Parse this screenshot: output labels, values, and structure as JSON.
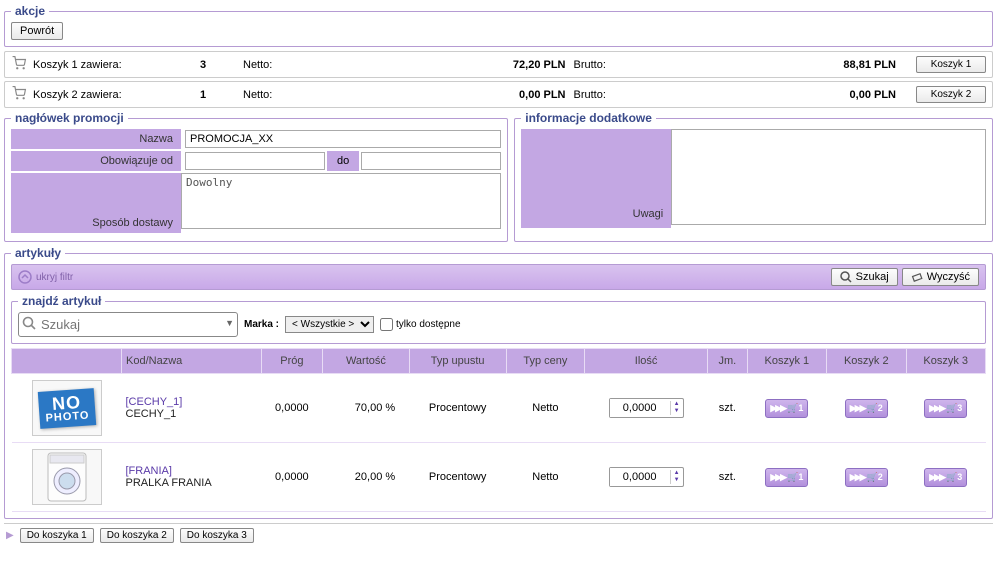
{
  "actions": {
    "legend": "akcje",
    "back": "Powrót"
  },
  "carts": [
    {
      "label": "Koszyk 1 zawiera:",
      "qty": "3",
      "netto_label": "Netto:",
      "netto": "72,20 PLN",
      "brutto_label": "Brutto:",
      "brutto": "88,81 PLN",
      "button": "Koszyk 1"
    },
    {
      "label": "Koszyk 2 zawiera:",
      "qty": "1",
      "netto_label": "Netto:",
      "netto": "0,00 PLN",
      "brutto_label": "Brutto:",
      "brutto": "0,00 PLN",
      "button": "Koszyk 2"
    }
  ],
  "promo_header": {
    "legend": "nagłówek promocji",
    "name_label": "Nazwa",
    "name_value": "PROMOCJA_XX",
    "from_label": "Obowiązuje od",
    "from_value": "",
    "to_label": "do",
    "to_value": "",
    "delivery_label": "Sposób dostawy",
    "delivery_value": "Dowolny"
  },
  "extra_info": {
    "legend": "informacje dodatkowe",
    "remarks_label": "Uwagi",
    "remarks_value": ""
  },
  "articles": {
    "legend": "artykuły",
    "hide_filter": "ukryj filtr",
    "search_btn": "Szukaj",
    "clear_btn": "Wyczyść",
    "find_legend": "znajdź artykuł",
    "search_placeholder": "Szukaj",
    "marka_label": "Marka :",
    "marka_selected": "< Wszystkie >",
    "only_available": "tylko dostępne",
    "columns": {
      "img": "",
      "code": "Kod/Nazwa",
      "threshold": "Próg",
      "value": "Wartość",
      "discount_type": "Typ upustu",
      "price_type": "Typ ceny",
      "qty": "Ilość",
      "unit": "Jm.",
      "k1": "Koszyk 1",
      "k2": "Koszyk 2",
      "k3": "Koszyk 3"
    },
    "rows": [
      {
        "code": "[CECHY_1]",
        "name": "CECHY_1",
        "threshold": "0,0000",
        "value": "70,00 %",
        "discount_type": "Procentowy",
        "price_type": "Netto",
        "qty": "0,0000",
        "unit": "szt.",
        "image": "nophoto"
      },
      {
        "code": "[FRANIA]",
        "name": "PRALKA FRANIA",
        "threshold": "0,0000",
        "value": "20,00 %",
        "discount_type": "Procentowy",
        "price_type": "Netto",
        "qty": "0,0000",
        "unit": "szt.",
        "image": "washer"
      }
    ]
  },
  "footer": {
    "b1": "Do koszyka 1",
    "b2": "Do koszyka 2",
    "b3": "Do koszyka 3"
  }
}
